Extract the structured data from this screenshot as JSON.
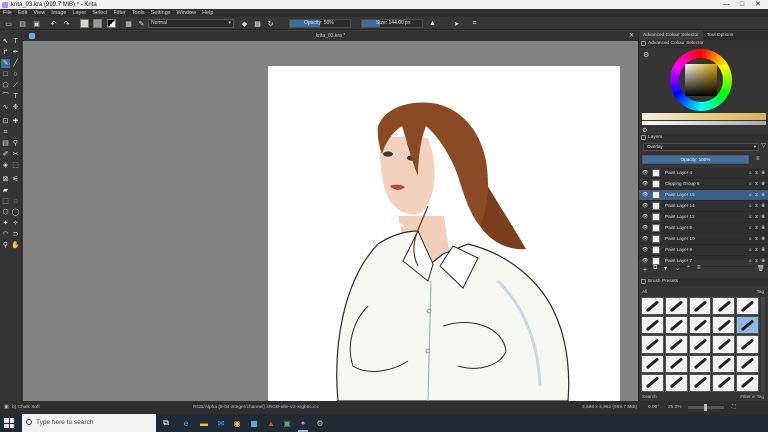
{
  "window": {
    "title": "krita_03.kra (999.7 MiB) * - Krita",
    "minimize": "—",
    "maximize": "□",
    "close": "✕"
  },
  "menu": [
    "File",
    "Edit",
    "View",
    "Image",
    "Layer",
    "Select",
    "Filter",
    "Tools",
    "Settings",
    "Window",
    "Help"
  ],
  "toolbar": {
    "blend_mode": "Normal",
    "opacity_label": "Opacity: 50%",
    "opacity_fraction": 0.5,
    "size_label": "Size: 144.00 px",
    "size_fraction": 0.3
  },
  "document": {
    "tab_title": "krita_03.kra *"
  },
  "docker": {
    "tabs": [
      "Advanced Colour Selector",
      "Tool Options"
    ],
    "colour_panel_title": "Advanced Colour Selector",
    "layers_title": "Layers",
    "blend_mode": "Overlay",
    "opacity_label": "Opacity: 100%",
    "layers": [
      {
        "name": "Paint Layer 4",
        "selected": false
      },
      {
        "name": "Clipping Group 6",
        "selected": false
      },
      {
        "name": "Paint Layer 15",
        "selected": true
      },
      {
        "name": "Paint Layer 14",
        "selected": false
      },
      {
        "name": "Paint Layer 12",
        "selected": false
      },
      {
        "name": "Paint Layer 8",
        "selected": false
      },
      {
        "name": "Paint Layer 10",
        "selected": false
      },
      {
        "name": "Paint Layer 9",
        "selected": false
      },
      {
        "name": "Paint Layer 7",
        "selected": false
      }
    ],
    "brush_title": "Brush Presets",
    "brush_filter_tag": "All",
    "brush_tag_label": "Tag",
    "brush_search_label": "Search",
    "filter_in_tag": "Filter in Tag"
  },
  "status": {
    "brush_name": "b) Chalk Soft",
    "color_info": "RGB/Alpha (8-bit integer/channel)  sRGB-elle-V2-srgbtrc.icc",
    "dimensions": "3,588 x 4,962 (999.7 MiB)",
    "angle": "0.00°",
    "zoom": "25.0%"
  },
  "taskbar": {
    "search_placeholder": "Type here to search"
  }
}
